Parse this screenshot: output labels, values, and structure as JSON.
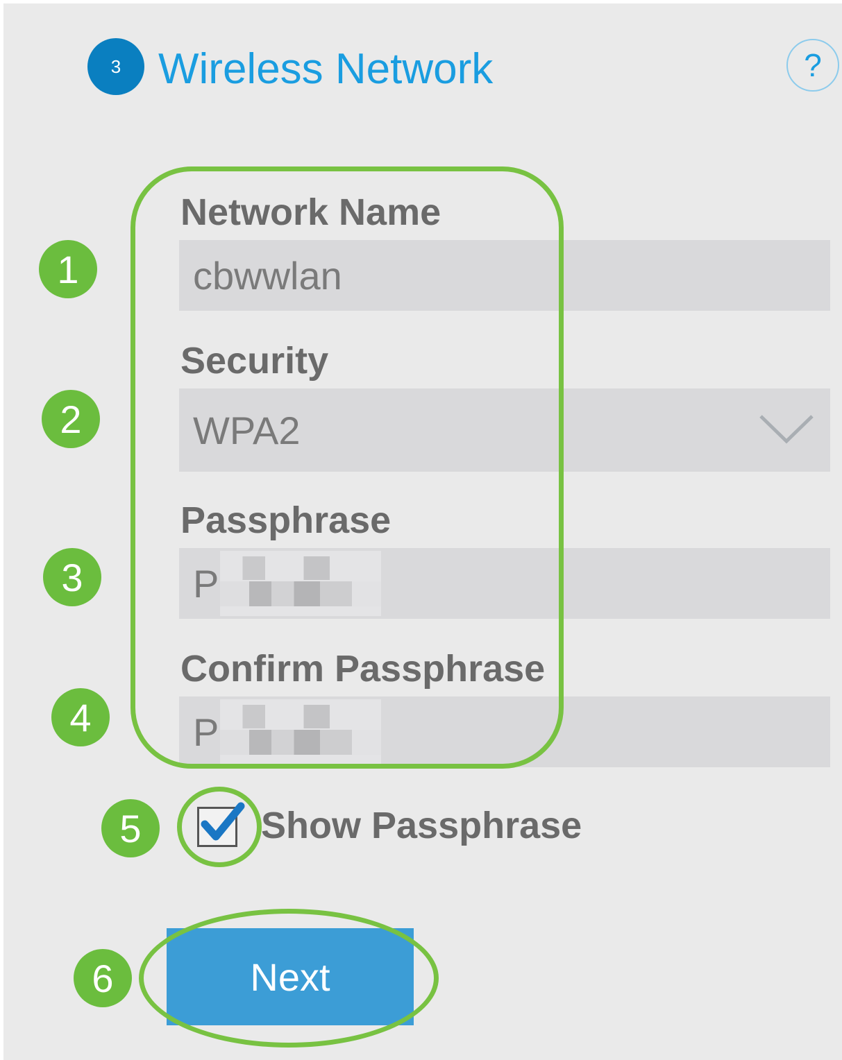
{
  "header": {
    "step_number": "3",
    "title": "Wireless Network",
    "help_label": "?"
  },
  "form": {
    "network_name": {
      "label": "Network Name",
      "value": "cbwwlan"
    },
    "security": {
      "label": "Security",
      "value": "WPA2"
    },
    "passphrase": {
      "label": "Passphrase",
      "value_prefix": "P"
    },
    "confirm_passphrase": {
      "label": "Confirm Passphrase",
      "value_prefix": "P"
    },
    "show_passphrase": {
      "label": "Show Passphrase",
      "checked": true
    },
    "next_label": "Next"
  },
  "annotations": {
    "badges": [
      "1",
      "2",
      "3",
      "4",
      "5",
      "6"
    ],
    "color": "#6bbd3e"
  },
  "colors": {
    "accent": "#1a9de0",
    "step_circle": "#0a7fc0",
    "button": "#3c9dd6",
    "annotation_ring": "#78c242"
  }
}
